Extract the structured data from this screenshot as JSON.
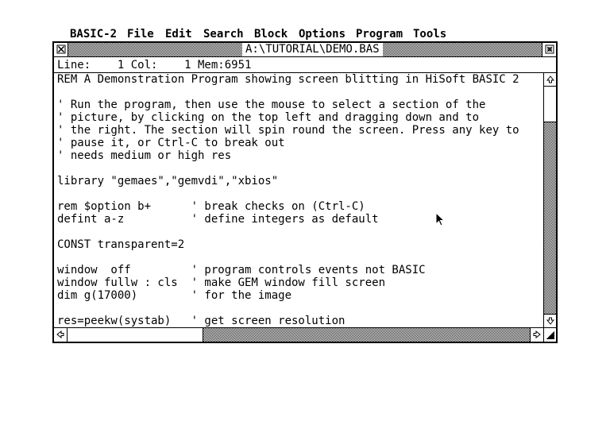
{
  "menubar": {
    "items": [
      "BASIC-2",
      "File",
      "Edit",
      "Search",
      "Block",
      "Options",
      "Program",
      "Tools"
    ]
  },
  "window": {
    "title": "A:\\TUTORIAL\\DEMO.BAS",
    "close_icon": "close-box-icon",
    "fuller_icon": "fuller-box-icon"
  },
  "infoline": {
    "text": "Line:    1 Col:    1 Mem:6951"
  },
  "editor": {
    "lines": [
      "REM A Demonstration Program showing screen blitting in HiSoft BASIC 2",
      "",
      "' Run the program, then use the mouse to select a section of the",
      "' picture, by clicking on the top left and dragging down and to",
      "' the right. The section will spin round the screen. Press any key to",
      "' pause it, or Ctrl-C to break out",
      "' needs medium or high res",
      "",
      "library \"gemaes\",\"gemvdi\",\"xbios\"",
      "",
      "rem $option b+      ' break checks on (Ctrl-C)",
      "defint a-z          ' define integers as default",
      "",
      "CONST transparent=2",
      "",
      "window  off         ' program controls events not BASIC",
      "window fullw : cls  ' make GEM window fill screen",
      "dim g(17000)        ' for the image",
      "",
      "res=peekw(systab)   ' get screen resolution"
    ]
  },
  "scrollbars": {
    "vertical_position": 0,
    "horizontal_position": 0
  },
  "icons": {
    "up": "scroll-up-arrow-icon",
    "down": "scroll-down-arrow-icon",
    "left": "scroll-left-arrow-icon",
    "right": "scroll-right-arrow-icon",
    "sizer": "resize-icon",
    "pointer": "mouse-pointer-icon"
  },
  "colors": {
    "foreground": "#000000",
    "background": "#ffffff"
  }
}
